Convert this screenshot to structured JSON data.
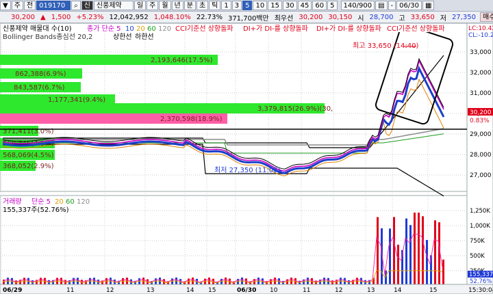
{
  "toolbar1": {
    "arrow_icon": "dropdown-arrow",
    "period_label": "주",
    "prev_label": "전",
    "code": "019170",
    "credit_badge": "신",
    "stock_name": "신풍제약",
    "tf_buttons": [
      "일",
      "주",
      "월",
      "년",
      "분",
      "초",
      "틱",
      "1",
      "3",
      "5",
      "10",
      "15",
      "30",
      "45",
      "60",
      "5"
    ],
    "count": "140/900",
    "date": "06/30",
    "calendar_icon": "calendar-icon"
  },
  "toolbar2": {
    "price": "30,200",
    "down_mark": "▲",
    "change": "1,500",
    "change_pct": "+5.23%",
    "volume": "12,042,952",
    "volume_pct": "1,048.10%",
    "turnover": "22.73%",
    "amount": "371,700백만",
    "prio_label": "최우선",
    "ask": "30,200",
    "bid": "30,150",
    "open_label": "시",
    "open": "28,700",
    "high_label": "고",
    "high": "33,650",
    "low_label": "저",
    "low": "27,350",
    "buy_label": "매수",
    "sell_label": "매도"
  },
  "legend": {
    "title": "신풍제약 매물대 수(10)",
    "items": [
      "종가 단순 5",
      "10",
      "20",
      "60",
      "120"
    ],
    "signals": [
      "CCI기준선 상향돌파",
      "DI+가 DI-를 상향돌파",
      "DI+가 DI-를 상향돌파",
      "CCI기준선 상향돌파"
    ],
    "bollinger": "Bollinger Bands종심선 20,2",
    "bb_up": "상한선",
    "bb_down": "하한선",
    "colors": {
      "ma5": "#c800c8",
      "ma10": "#e08000",
      "ma20": "#ffc000",
      "ma60": "#1d9b1d",
      "ma120": "#8c8c8c"
    }
  },
  "price_axis": {
    "ticks": [
      "33,000",
      "32,000",
      "31,000",
      "30,000",
      "29,000",
      "28,000",
      "27,000"
    ],
    "top_labels": [
      "LC:10.42",
      "CL:-10.2"
    ],
    "current_tag": "30,200",
    "pct_tag": "0.83%"
  },
  "volume_profile": [
    {
      "label": "2,193,646(17.5%)"
    },
    {
      "label": "862,388(6.9%)"
    },
    {
      "label": "843,587(6.7%)"
    },
    {
      "label": "1,177,341(9.4%)"
    },
    {
      "label": "3,379,815(26.9%)(30,"
    },
    {
      "label": "2,370,598(18.9%)"
    },
    {
      "label": "371,411(3.0%)"
    },
    {
      "label": "568,745(4.5%)"
    },
    {
      "label": "568,069(4.5%)"
    },
    {
      "label": "368,052(2.9%)"
    }
  ],
  "annotations": {
    "high": "최고 33,650 (14:40)",
    "low": "최저 27,350 (11:05)"
  },
  "volume_panel": {
    "title": "거래량",
    "items": [
      "단순 5",
      "20",
      "60",
      "120"
    ],
    "current": "155,337주(52.76%)",
    "ticks": [
      "1,250K",
      "1,000K",
      "750K",
      "500K",
      "250K"
    ],
    "tags": [
      "155,337",
      "52.76%"
    ],
    "colors": {
      "up": "#e0001a",
      "down": "#1e3ad6"
    }
  },
  "time_axis": {
    "labels": [
      "06/29",
      "11",
      "12",
      "13",
      "14",
      "15",
      "06/30",
      "10",
      "11",
      "12",
      "13",
      "14",
      "15"
    ],
    "right": "15:30:04"
  }
}
